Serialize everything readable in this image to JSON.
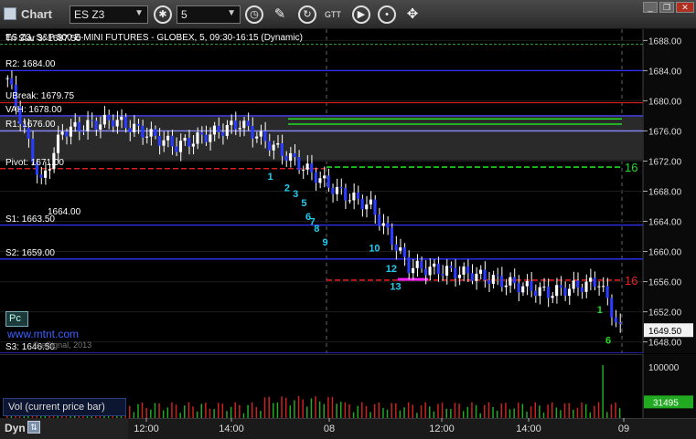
{
  "window": {
    "title": "Chart",
    "symbol": "ES Z3",
    "interval": "5",
    "controls": [
      "minimize-icon",
      "restore-icon",
      "close-icon"
    ]
  },
  "toolbar_icons": [
    "settings-icon",
    "clock-icon",
    "pencil-icon",
    "refresh-icon",
    "gtt-icon",
    "play-icon",
    "move-icon"
  ],
  "chart_header": "ES Z3, S&P 500 E-MINI FUTURES - GLOBEX, 5, 09:30-16:15 (Dynamic)",
  "level_labels": [
    {
      "text": "Tri Star 3: 1687.50",
      "price": 1687.5
    },
    {
      "text": "R2: 1684.00",
      "price": 1684.0
    },
    {
      "text": "UBreak: 1679.75",
      "price": 1679.75
    },
    {
      "text": "VAH: 1678.00",
      "price": 1678.0
    },
    {
      "text": "R1: 1676.00",
      "price": 1676.0
    },
    {
      "text": "Pivot: 1671.00",
      "price": 1671.0
    },
    {
      "text": "S1: 1663.50",
      "price": 1663.5
    },
    {
      "text": "S2: 1659.00",
      "price": 1659.0
    },
    {
      "text": "S3: 1646.50",
      "price": 1646.5
    }
  ],
  "partial_label": "1664.00",
  "watermark": "www.mtnt.com",
  "copyright": "© eSignal, 2013",
  "pc_badge": "Pc",
  "chart_data": {
    "type": "candlestick",
    "y_ticks": [
      "1688.00",
      "1684.00",
      "1680.00",
      "1676.00",
      "1672.00",
      "1668.00",
      "1664.00",
      "1660.00",
      "1656.00",
      "1652.00",
      "1648.00"
    ],
    "ylim": [
      1646.5,
      1689.5
    ],
    "last_price": "1649.50",
    "x_ticks": [
      "12:00",
      "14:00",
      "08",
      "12:00",
      "14:00",
      "09"
    ],
    "right_markers": [
      {
        "text": "16",
        "price": 1671.2,
        "color": "#22dd22"
      },
      {
        "text": "16",
        "price": 1656.2,
        "color": "#ee2222"
      }
    ],
    "td_counts": [
      {
        "text": "1",
        "bar": 62,
        "price": 1669.5,
        "color": "#22ccee"
      },
      {
        "text": "2",
        "bar": 66,
        "price": 1668.0,
        "color": "#22ccee"
      },
      {
        "text": "3",
        "bar": 68,
        "price": 1667.2,
        "color": "#22ccee"
      },
      {
        "text": "5",
        "bar": 70,
        "price": 1666.0,
        "color": "#22ccee"
      },
      {
        "text": "6",
        "bar": 71,
        "price": 1664.2,
        "color": "#22ccee"
      },
      {
        "text": "7",
        "bar": 72,
        "price": 1663.5,
        "color": "#22ccee"
      },
      {
        "text": "8",
        "bar": 73,
        "price": 1662.6,
        "color": "#22ccee"
      },
      {
        "text": "9",
        "bar": 75,
        "price": 1660.8,
        "color": "#22ccee"
      },
      {
        "text": "10",
        "bar": 86,
        "price": 1660.0,
        "color": "#22ccee"
      },
      {
        "text": "12",
        "bar": 90,
        "price": 1657.3,
        "color": "#22ccee"
      },
      {
        "text": "13",
        "bar": 91,
        "price": 1654.9,
        "color": "#22ccee"
      },
      {
        "text": "1",
        "bar": 140,
        "price": 1651.8,
        "color": "#22dd22"
      },
      {
        "text": "6",
        "bar": 142,
        "price": 1647.8,
        "color": "#22dd22"
      }
    ],
    "volume": {
      "y_ticks": [
        "100000"
      ],
      "last_value": "31495",
      "ylim": [
        0,
        125000
      ],
      "label": "Vol (current price bar)"
    }
  },
  "status": {
    "label": "Dyn"
  }
}
